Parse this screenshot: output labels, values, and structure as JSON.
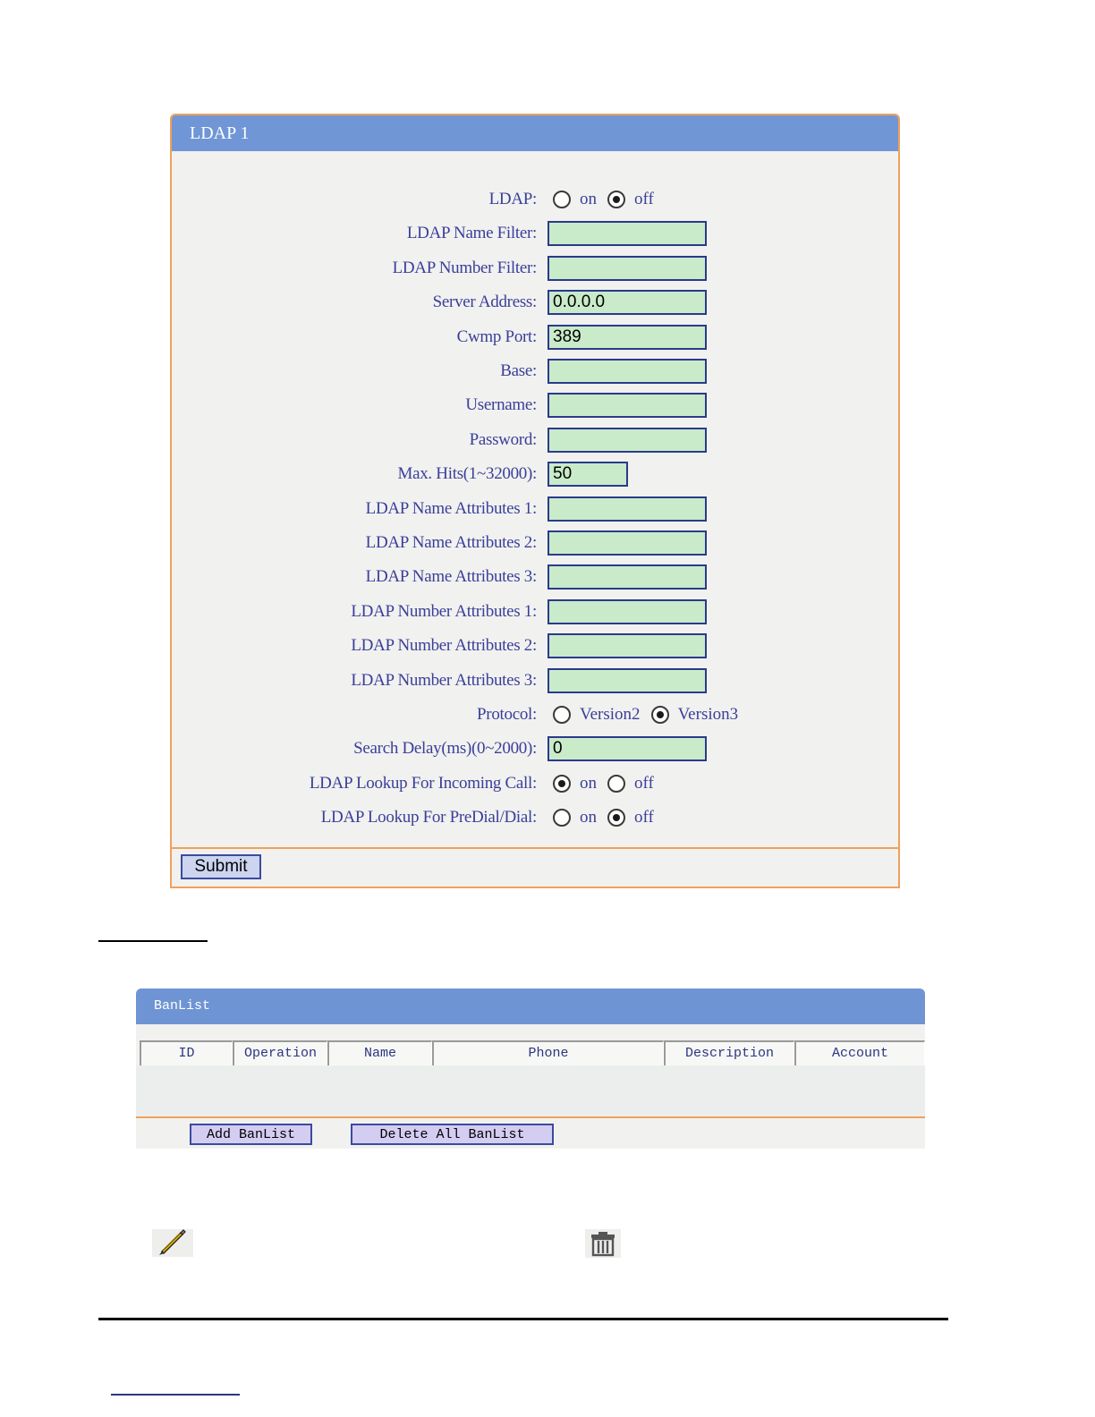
{
  "ldap": {
    "title": "LDAP 1",
    "rows": [
      {
        "label": "LDAP:",
        "type": "radio",
        "options": [
          "on",
          "off"
        ],
        "selected": "off"
      },
      {
        "label": "LDAP Name Filter:",
        "type": "text",
        "value": ""
      },
      {
        "label": "LDAP Number Filter:",
        "type": "text",
        "value": ""
      },
      {
        "label": "Server Address:",
        "type": "text",
        "value": "0.0.0.0"
      },
      {
        "label": "Cwmp Port:",
        "type": "text",
        "value": "389"
      },
      {
        "label": "Base:",
        "type": "text",
        "value": ""
      },
      {
        "label": "Username:",
        "type": "text",
        "value": ""
      },
      {
        "label": "Password:",
        "type": "text",
        "value": ""
      },
      {
        "label": "Max. Hits(1~32000):",
        "type": "text-short",
        "value": "50"
      },
      {
        "label": "LDAP Name Attributes 1:",
        "type": "text",
        "value": ""
      },
      {
        "label": "LDAP Name Attributes 2:",
        "type": "text",
        "value": ""
      },
      {
        "label": "LDAP Name Attributes 3:",
        "type": "text",
        "value": ""
      },
      {
        "label": "LDAP Number Attributes 1:",
        "type": "text",
        "value": ""
      },
      {
        "label": "LDAP Number Attributes 2:",
        "type": "text",
        "value": ""
      },
      {
        "label": "LDAP Number Attributes 3:",
        "type": "text",
        "value": ""
      },
      {
        "label": "Protocol:",
        "type": "radio",
        "options": [
          "Version2",
          "Version3"
        ],
        "selected": "Version3"
      },
      {
        "label": "Search Delay(ms)(0~2000):",
        "type": "text",
        "value": "0"
      },
      {
        "label": "LDAP Lookup For Incoming Call:",
        "type": "radio",
        "options": [
          "on",
          "off"
        ],
        "selected": "on"
      },
      {
        "label": "LDAP Lookup For PreDial/Dial:",
        "type": "radio",
        "options": [
          "on",
          "off"
        ],
        "selected": "off"
      }
    ],
    "submit_label": "Submit"
  },
  "banlist": {
    "title": "BanList",
    "columns": [
      "ID",
      "Operation",
      "Name",
      "Phone",
      "Description",
      "Account"
    ],
    "add_label": "Add BanList",
    "delete_all_label": "Delete All BanList"
  },
  "icons": [
    "pencil-edit-icon",
    "trash-delete-icon"
  ]
}
